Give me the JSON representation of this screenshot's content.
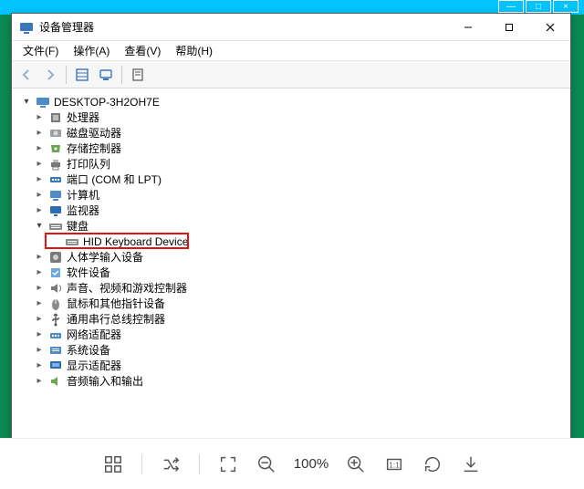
{
  "bg_window": {
    "minimize": "—",
    "maximize": "□",
    "close": "×"
  },
  "window": {
    "title": "设备管理器",
    "controls": {
      "minimize": "—",
      "maximize": "□",
      "close": "×"
    }
  },
  "menu": {
    "file": "文件(F)",
    "action": "操作(A)",
    "view": "查看(V)",
    "help": "帮助(H)"
  },
  "toolbar": {
    "back": "back",
    "forward": "forward",
    "show_hidden": "show-hidden",
    "refresh": "refresh",
    "properties": "properties"
  },
  "tree": {
    "root": "DESKTOP-3H2OH7E",
    "items": [
      {
        "label": "处理器",
        "icon": "cpu"
      },
      {
        "label": "磁盘驱动器",
        "icon": "disk"
      },
      {
        "label": "存储控制器",
        "icon": "storage"
      },
      {
        "label": "打印队列",
        "icon": "printer"
      },
      {
        "label": "端口 (COM 和 LPT)",
        "icon": "port"
      },
      {
        "label": "计算机",
        "icon": "computer"
      },
      {
        "label": "监视器",
        "icon": "monitor"
      },
      {
        "label": "键盘",
        "icon": "keyboard",
        "expanded": true,
        "children": [
          {
            "label": "HID Keyboard Device",
            "icon": "keyboard",
            "highlighted": true
          }
        ]
      },
      {
        "label": "人体学输入设备",
        "icon": "hid"
      },
      {
        "label": "软件设备",
        "icon": "software"
      },
      {
        "label": "声音、视频和游戏控制器",
        "icon": "sound"
      },
      {
        "label": "鼠标和其他指针设备",
        "icon": "mouse"
      },
      {
        "label": "通用串行总线控制器",
        "icon": "usb"
      },
      {
        "label": "网络适配器",
        "icon": "network"
      },
      {
        "label": "系统设备",
        "icon": "system"
      },
      {
        "label": "显示适配器",
        "icon": "display"
      },
      {
        "label": "音频输入和输出",
        "icon": "audio"
      }
    ]
  },
  "viewer": {
    "zoom": "100%"
  }
}
